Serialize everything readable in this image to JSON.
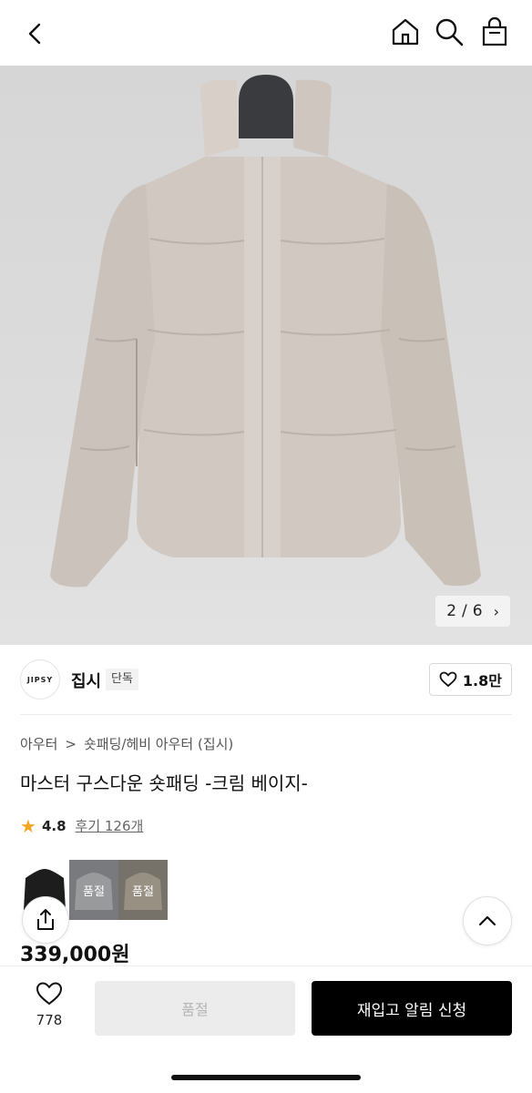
{
  "header": {
    "back_icon": "chevron-left-icon",
    "home_icon": "home-icon",
    "search_icon": "search-icon",
    "bag_icon": "shopping-bag-icon"
  },
  "gallery": {
    "current": "2",
    "separator": "/",
    "total": "6",
    "next_icon": "chevron-right-icon"
  },
  "brand": {
    "logo_text": "JIPSY",
    "name": "집시",
    "badge": "단독",
    "likes": "1.8만"
  },
  "breadcrumb": {
    "category": "아우터",
    "separator": ">",
    "subcategory": "숏패딩/헤비 아우터 (집시)"
  },
  "product": {
    "title": "마스터 구스다운 숏패딩 -크림 베이지-",
    "rating": "4.8",
    "reviews": "후기 126개",
    "price": "339,000원"
  },
  "thumbnails": [
    {
      "label": ""
    },
    {
      "label": "품절"
    },
    {
      "label": "품절"
    }
  ],
  "action_bar": {
    "wish_count": "778",
    "soldout_label": "품절",
    "restock_label": "재입고 알림 신청"
  },
  "colors": {
    "accent_star": "#f5a623",
    "primary_button": "#000000",
    "disabled_button": "#ececec"
  }
}
